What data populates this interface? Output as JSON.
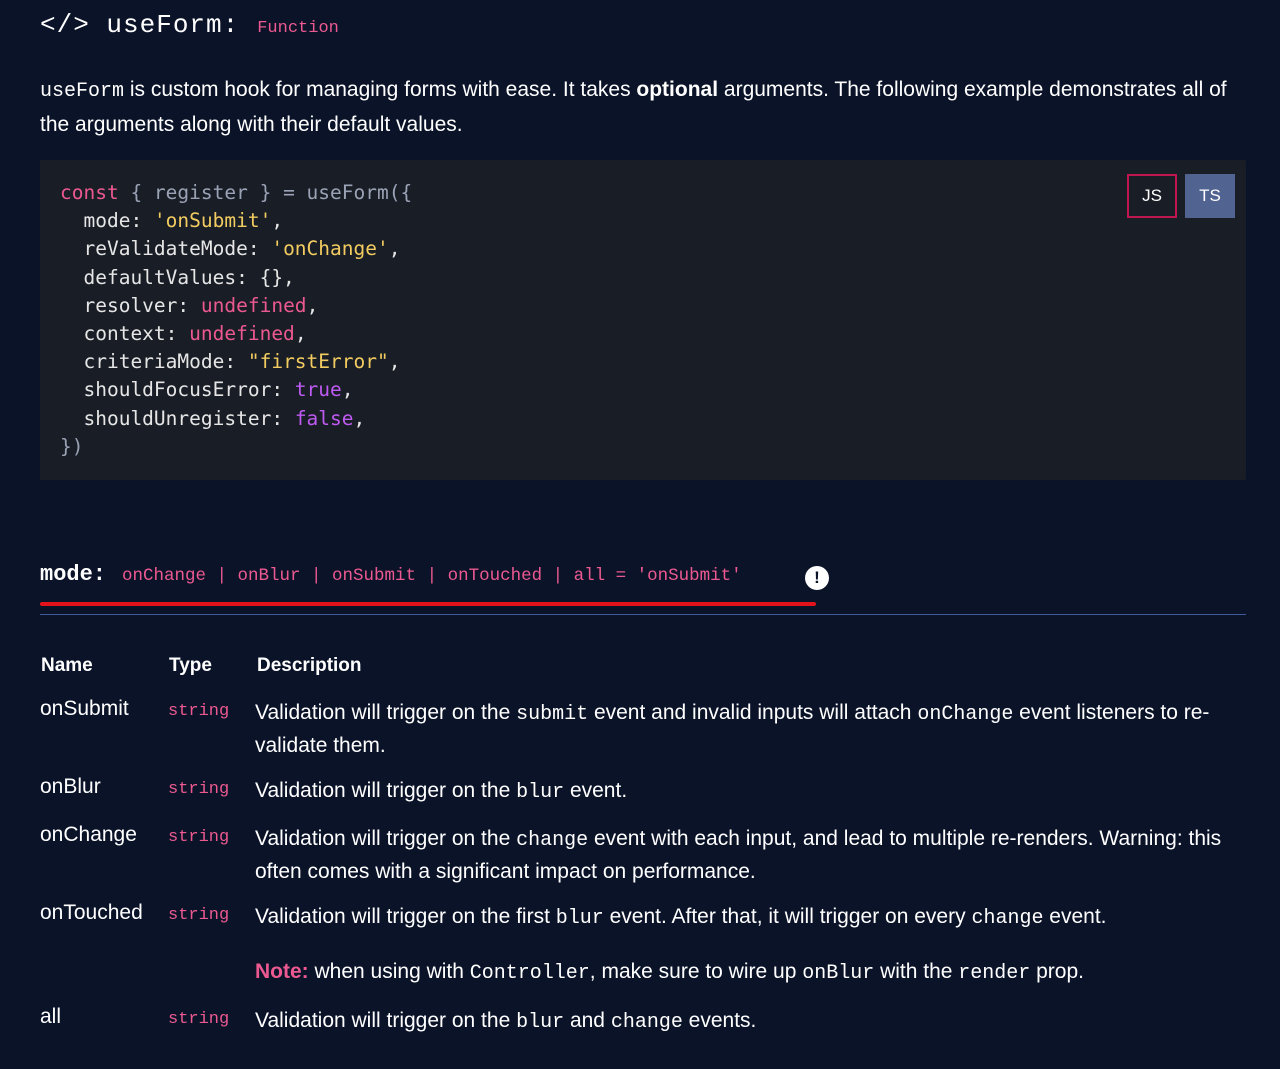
{
  "header": {
    "title": "</> useForm:",
    "kind": "Function"
  },
  "intro": {
    "code": "useForm",
    "part1": " is custom hook for managing forms with ease. It takes ",
    "bold": "optional",
    "part2": " arguments. The following example demonstrates all of the arguments along with their default values."
  },
  "code_block": {
    "lines": [
      [
        "const",
        " { register } = useForm({"
      ],
      [
        "  mode: ",
        "'onSubmit'",
        ","
      ],
      [
        "  reValidateMode: ",
        "'onChange'",
        ","
      ],
      [
        "  defaultValues: {},"
      ],
      [
        "  resolver: ",
        "undefined",
        ","
      ],
      [
        "  context: ",
        "undefined",
        ","
      ],
      [
        "  criteriaMode: ",
        "\"firstError\"",
        ","
      ],
      [
        "  shouldFocusError: ",
        "true",
        ","
      ],
      [
        "  shouldUnregister: ",
        "false",
        ","
      ],
      [
        "})"
      ]
    ],
    "js_label": "JS",
    "ts_label": "TS"
  },
  "mode_section": {
    "name": "mode:",
    "types": "onChange | onBlur | onSubmit | onTouched | all = 'onSubmit'",
    "warn_glyph": "!"
  },
  "table": {
    "headers": {
      "name": "Name",
      "type": "Type",
      "description": "Description"
    },
    "rows": [
      {
        "name": "onSubmit",
        "type": "string",
        "d1": "Validation will trigger on the ",
        "c1": "submit",
        "d2": " event and invalid inputs will attach ",
        "c2": "onChange",
        "d3": " event listeners to re-validate them."
      },
      {
        "name": "onBlur",
        "type": "string",
        "d1": "Validation will trigger on the ",
        "c1": "blur",
        "d2": " event."
      },
      {
        "name": "onChange",
        "type": "string",
        "d1": "Validation will trigger on the ",
        "c1": "change",
        "d2": " event with each input, and lead to multiple re-renders. Warning: this often comes with a significant impact on performance."
      },
      {
        "name": "onTouched",
        "type": "string",
        "d1": "Validation will trigger on the first ",
        "c1": "blur",
        "d2": " event. After that, it will trigger on every ",
        "c2": "change",
        "d3": " event."
      },
      {
        "name": "all",
        "type": "string",
        "d1": "Validation will trigger on the ",
        "c1": "blur",
        "d2": " and ",
        "c2": "change",
        "d3": " events."
      }
    ],
    "note": {
      "label": "Note:",
      "t1": " when using with ",
      "c1": "Controller",
      "t2": ", make sure to wire up ",
      "c2": "onBlur",
      "t3": " with the ",
      "c3": "render",
      "t4": " prop."
    }
  }
}
